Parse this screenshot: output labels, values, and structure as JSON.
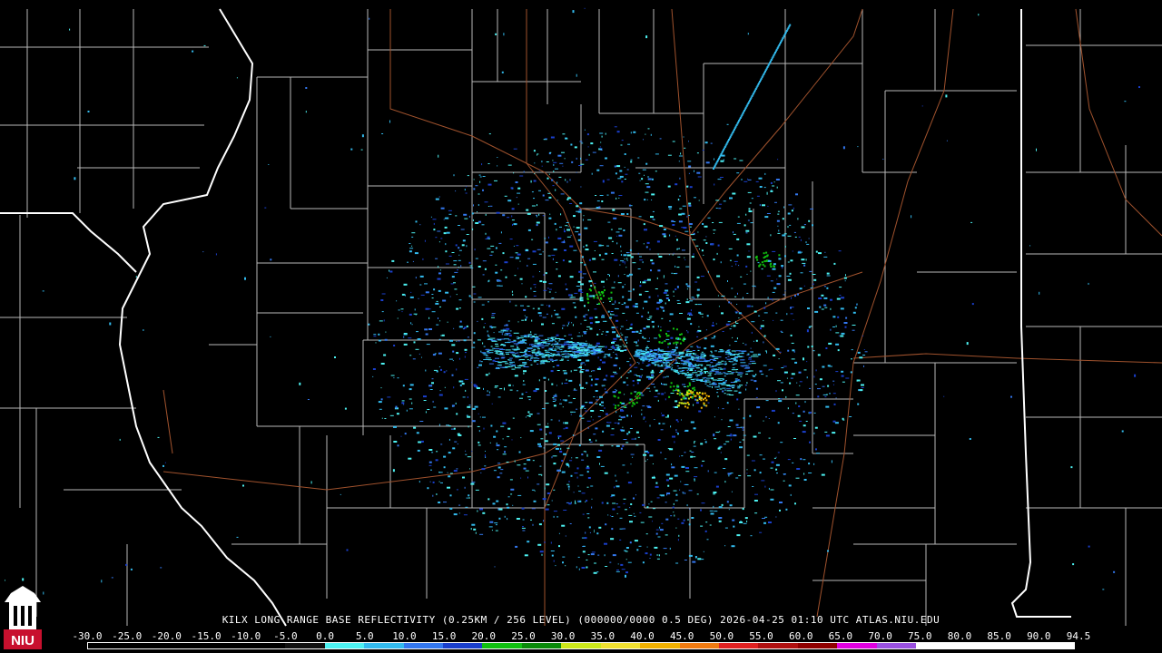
{
  "caption": "KILX LONG RANGE BASE REFLECTIVITY (0.25KM / 256 LEVEL) (000000/0000 0.5 DEG) 2026-04-25 01:10 UTC  ATLAS.NIU.EDU",
  "logo_text": "NIU",
  "scale": {
    "labels": [
      "-30.0",
      "-25.0",
      "-20.0",
      "-15.0",
      "-10.0",
      "-5.0",
      "0.0",
      "5.0",
      "10.0",
      "15.0",
      "20.0",
      "25.0",
      "30.0",
      "35.0",
      "40.0",
      "45.0",
      "50.0",
      "55.0",
      "60.0",
      "65.0",
      "70.0",
      "75.0",
      "80.0",
      "85.0",
      "90.0",
      "94.5"
    ],
    "colors": [
      "#000000",
      "#000000",
      "#000000",
      "#000000",
      "#000000",
      "#111111",
      "#4df2f2",
      "#33bbee",
      "#3377ee",
      "#1a3fcc",
      "#10c010",
      "#0a8a0a",
      "#cce81a",
      "#f0e030",
      "#f0b000",
      "#f07a10",
      "#e02020",
      "#b01010",
      "#900000",
      "#e000e0",
      "#9a50e0",
      "#ffffff",
      "#ffffff",
      "#ffffff",
      "#ffffff"
    ]
  },
  "colors": {
    "state_border": "#ffffff",
    "county_border": "#b8b8b8",
    "highway": "#a0522d"
  }
}
